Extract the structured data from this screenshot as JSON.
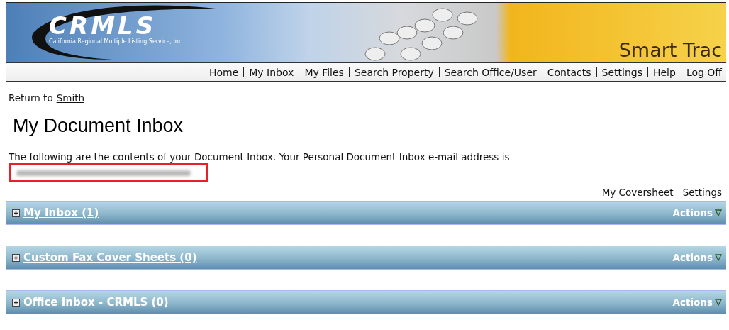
{
  "banner": {
    "logo": "CRMLS",
    "logo_subtitle": "California Regional Multiple Listing Service, Inc.",
    "product": "Smart Trac"
  },
  "nav": [
    "Home",
    "My Inbox",
    "My Files",
    "Search Property",
    "Search Office/User",
    "Contacts",
    "Settings",
    "Help",
    "Log Off"
  ],
  "return_link": {
    "prefix": "Return to",
    "link": "Smith"
  },
  "title": "My Document Inbox",
  "intro": "The following are the contents of your Document Inbox. Your Personal Document Inbox e-mail address is",
  "toolbar_links": [
    "My Coversheet",
    "Settings"
  ],
  "panels": [
    {
      "title": "My Inbox (1)",
      "actions": "Actions",
      "expanded": false
    },
    {
      "title": "Custom Fax Cover Sheets (0)",
      "actions": "Actions",
      "expanded": false
    },
    {
      "title": "Office Inbox - CRMLS (0)",
      "actions": "Actions",
      "expanded": false
    }
  ]
}
